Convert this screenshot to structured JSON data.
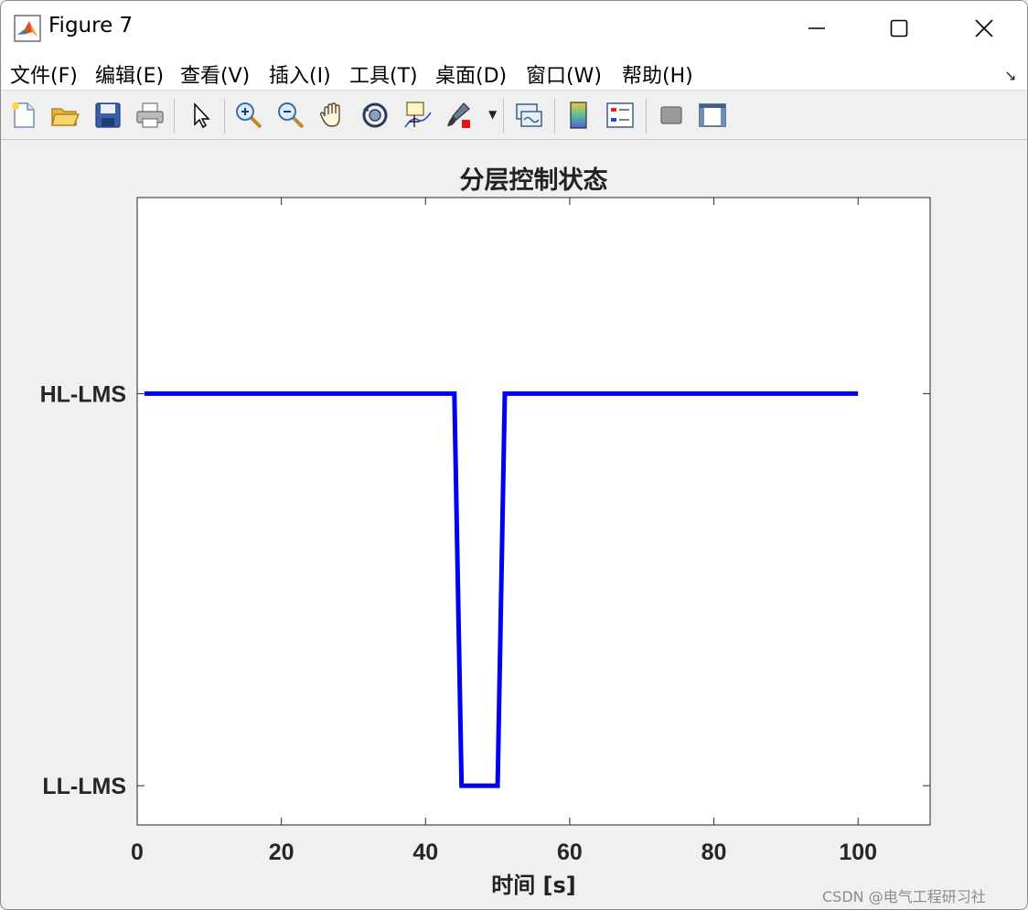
{
  "window": {
    "title": "Figure 7",
    "min_icon": "minimize-icon",
    "max_icon": "maximize-icon",
    "close_icon": "close-icon"
  },
  "menu": {
    "items": [
      "文件(F)",
      "编辑(E)",
      "查看(V)",
      "插入(I)",
      "工具(T)",
      "桌面(D)",
      "窗口(W)",
      "帮助(H)"
    ],
    "overflow_icon": "expand-arrow-icon"
  },
  "toolbar": {
    "icons": [
      "new-figure-icon",
      "open-file-icon",
      "save-icon",
      "print-icon",
      "select-pointer-icon",
      "zoom-in-icon",
      "zoom-out-icon",
      "pan-hand-icon",
      "rotate-3d-icon",
      "data-cursor-icon",
      "brush-icon",
      "link-plot-icon",
      "colorbar-icon",
      "legend-icon",
      "hide-plot-tools-icon",
      "show-plot-tools-icon"
    ]
  },
  "chart_data": {
    "type": "line",
    "title": "分层控制状态",
    "xlabel": "时间 [s]",
    "ylabel": "",
    "xlim": [
      0,
      110
    ],
    "ylim": [
      -0.1,
      1.5
    ],
    "xticks": [
      0,
      20,
      40,
      60,
      80,
      100
    ],
    "yticks": [
      0,
      1
    ],
    "ytick_labels": [
      "LL-LMS",
      "HL-LMS"
    ],
    "grid": false,
    "series": [
      {
        "color": "#0000ee",
        "x": [
          1,
          44,
          45,
          50,
          51,
          100
        ],
        "y": [
          1,
          1,
          0,
          0,
          1,
          1
        ]
      }
    ]
  },
  "watermark": "CSDN @电气工程研习社"
}
